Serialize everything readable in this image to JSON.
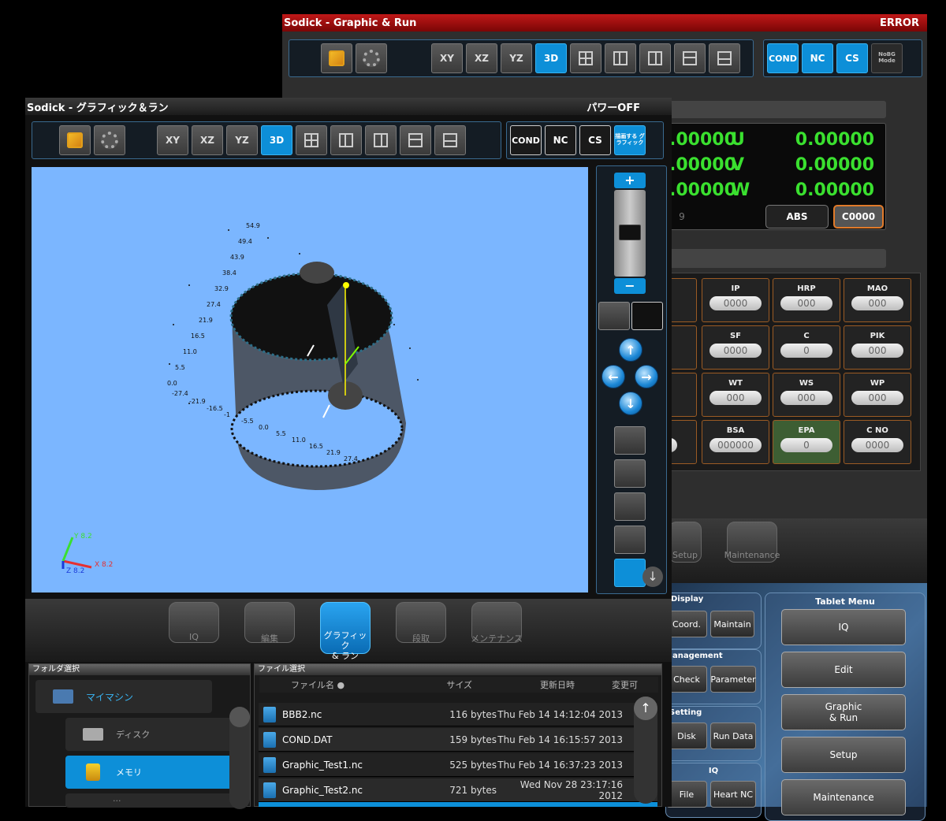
{
  "back_window": {
    "title": "Sodick - Graphic & Run",
    "status": "ERROR",
    "toolbar": {
      "views": [
        "XY",
        "XZ",
        "YZ",
        "3D"
      ],
      "right_buttons": [
        "COND",
        "NC",
        "CS",
        "NoBG Mode"
      ]
    },
    "coords": [
      {
        "left": ".00000",
        "axis": "U",
        "right": "0.00000"
      },
      {
        "left": ".00000",
        "axis": "V",
        "right": "0.00000"
      },
      {
        "left": ".00000",
        "axis": "W",
        "right": "0.00000"
      }
    ],
    "coord_partial": "9",
    "abs_label": "ABS",
    "c_label": "C0000",
    "params": [
      {
        "label": "IP",
        "value": "0000"
      },
      {
        "label": "HRP",
        "value": "000"
      },
      {
        "label": "MAO",
        "value": "000"
      },
      {
        "label": "SF",
        "value": "0000"
      },
      {
        "label": "C",
        "value": "0"
      },
      {
        "label": "PIK",
        "value": "000"
      },
      {
        "label": "WT",
        "value": "000"
      },
      {
        "label": "WS",
        "value": "000"
      },
      {
        "label": "WP",
        "value": "000"
      },
      {
        "label": "BSA",
        "value": "000000"
      },
      {
        "label": "EPA",
        "value": "0"
      },
      {
        "label": "C NO",
        "value": "0000"
      }
    ],
    "partial_params": [
      "00"
    ],
    "bottom_menu": {
      "setup": "Setup",
      "maintenance": "Maintenance"
    },
    "display_card": {
      "title": "Display",
      "buttons": [
        "Coord.",
        "Maintain"
      ]
    },
    "management_card": {
      "title": "Management",
      "buttons": [
        "Check",
        "Parameter"
      ]
    },
    "setting_card": {
      "title": "Setting",
      "buttons": [
        "Disk",
        "Run Data"
      ]
    },
    "iq_card": {
      "title": "IQ",
      "buttons": [
        "File",
        "Heart NC"
      ]
    },
    "tablet_menu": {
      "title": "Tablet Menu",
      "items": [
        "IQ",
        "Edit",
        "Graphic\n& Run",
        "Setup",
        "Maintenance"
      ]
    }
  },
  "front_window": {
    "title": "Sodick - グラフィック＆ラン",
    "status": "パワーOFF",
    "toolbar": {
      "views": [
        "XY",
        "XZ",
        "YZ",
        "3D"
      ],
      "right_buttons": [
        "COND",
        "NC",
        "CS",
        "描画する グラフィック"
      ]
    },
    "viewport_bg": "#7bb6ff",
    "y_labels": [
      "54.9",
      "49.4",
      "43.9",
      "38.4",
      "32.9",
      "27.4",
      "21.9",
      "16.5",
      "11.0",
      "5.5",
      "0.0"
    ],
    "x_labels": [
      "-27.4",
      "-21.9",
      "-16.5",
      "-1",
      "-5.5",
      "0.0",
      "5.5",
      "11.0",
      "16.5",
      "21.9",
      "27.4"
    ],
    "axis_labels": {
      "x": "X 8.2",
      "y": "Y 8.2",
      "z": "Z 8.2"
    },
    "tabs": [
      {
        "label": "IQ",
        "selected": false
      },
      {
        "label": "編集",
        "selected": false
      },
      {
        "label": "グラフィック\n& ラン",
        "selected": true
      },
      {
        "label": "段取",
        "selected": false
      },
      {
        "label": "メンテナンス",
        "selected": false
      }
    ],
    "folder_panel": {
      "title": "フォルダ選択",
      "items": [
        {
          "label": "マイマシン",
          "selected": false
        },
        {
          "label": "ディスク",
          "selected": false
        },
        {
          "label": "メモリ",
          "selected": true
        },
        {
          "label": "...",
          "selected": false
        }
      ]
    },
    "file_panel": {
      "title": "ファイル選択",
      "headers": [
        "ファイル名",
        "サイズ",
        "更新日時",
        "変更可"
      ],
      "rows": [
        {
          "name": "BBB2.nc",
          "size": "116 bytes",
          "date": "Thu Feb 14 14:12:04 2013"
        },
        {
          "name": "COND.DAT",
          "size": "159 bytes",
          "date": "Thu Feb 14 16:15:57 2013"
        },
        {
          "name": "Graphic_Test1.nc",
          "size": "525 bytes",
          "date": "Thu Feb 14 16:37:23 2013"
        },
        {
          "name": "Graphic_Test2.nc",
          "size": "721 bytes",
          "date": "Wed Nov 28 23:17:16 2012"
        }
      ]
    }
  }
}
